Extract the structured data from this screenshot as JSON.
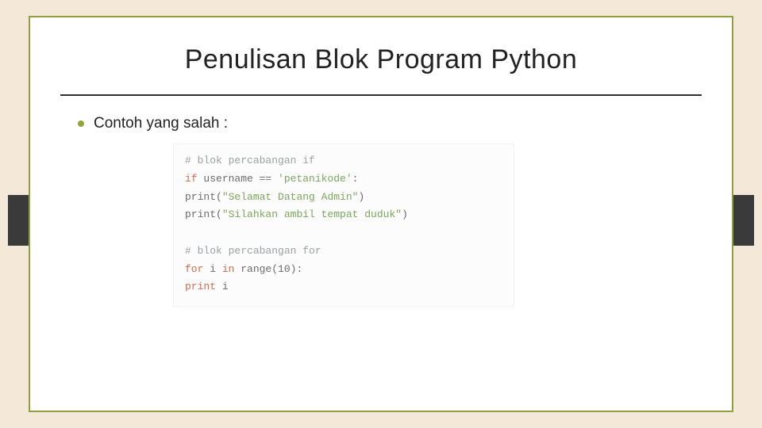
{
  "title": "Penulisan Blok Program Python",
  "bullet": "Contoh yang salah :",
  "code": {
    "l1_comment": "# blok percabangan if",
    "l2_kw": "if",
    "l2_ident": " username ",
    "l2_op": "==",
    "l2_space": " ",
    "l2_str": "'petanikode'",
    "l2_colon": ":",
    "l3_fn": "print",
    "l3_paren_open": "(",
    "l3_str": "\"Selamat Datang Admin\"",
    "l3_paren_close": ")",
    "l4_fn": "print",
    "l4_paren_open": "(",
    "l4_str": "\"Silahkan ambil tempat duduk\"",
    "l4_paren_close": ")",
    "l5_blank": " ",
    "l6_comment": "# blok percabangan for",
    "l7_kw1": "for",
    "l7_ident1": " i ",
    "l7_kw2": "in",
    "l7_fn": " range",
    "l7_paren_open": "(",
    "l7_num": "10",
    "l7_paren_close": ")",
    "l7_colon": ":",
    "l8_kw": "print",
    "l8_ident": " i"
  }
}
